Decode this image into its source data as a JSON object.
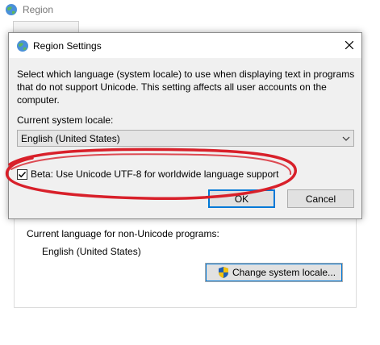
{
  "background_window": {
    "title": "Region",
    "non_unicode_label": "Current language for non-Unicode programs:",
    "non_unicode_value": "English (United States)",
    "change_button_label": "Change system locale..."
  },
  "dialog": {
    "title": "Region Settings",
    "description": "Select which language (system locale) to use when displaying text in programs that do not support Unicode. This setting affects all user accounts on the computer.",
    "locale_label": "Current system locale:",
    "locale_value": "English (United States)",
    "beta_checkbox_label": "Beta: Use Unicode UTF-8 for worldwide language support",
    "beta_checked": true,
    "ok_label": "OK",
    "cancel_label": "Cancel"
  },
  "annotation": {
    "color": "#d8202a",
    "shape": "ellipse"
  },
  "accent_color": "#0078d7"
}
